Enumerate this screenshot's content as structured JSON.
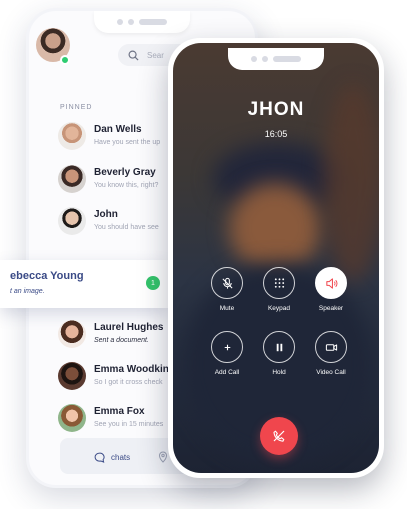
{
  "chat_app": {
    "search": {
      "placeholder": "Sear"
    },
    "pinned_label": "PINNED",
    "chats": [
      {
        "name": "Dan Wells",
        "message": "Have you sent the up"
      },
      {
        "name": "Beverly Gray",
        "message": "You know this, right?"
      },
      {
        "name": "John",
        "message": "You should have see"
      }
    ],
    "highlighted_chat": {
      "name": "ebecca Young",
      "message": "t an image.",
      "unread_count": "1"
    },
    "recent_chats": [
      {
        "name": "Laurel Hughes",
        "message": "Sent a document."
      },
      {
        "name": "Emma Woodkin",
        "message": "So I got it cross check"
      },
      {
        "name": "Emma Fox",
        "message": "See you in 15 minutes"
      }
    ],
    "tabbar": {
      "chats_label": "chats"
    },
    "colors": {
      "accent": "#3a4a86",
      "online": "#2ecc71",
      "badge": "#34c46b"
    }
  },
  "call_screen": {
    "caller_name": "JHON",
    "duration": "16:05",
    "controls": [
      {
        "label": "Mute",
        "icon": "mic-off-icon"
      },
      {
        "label": "Keypad",
        "icon": "keypad-icon"
      },
      {
        "label": "Speaker",
        "icon": "speaker-icon",
        "active": true
      },
      {
        "label": "Add Call",
        "icon": "plus-icon"
      },
      {
        "label": "Hold",
        "icon": "pause-icon"
      },
      {
        "label": "Video Call",
        "icon": "video-icon"
      }
    ],
    "end_call_icon": "phone-hangup-icon",
    "colors": {
      "end_call": "#f0464d",
      "speaker_icon": "#f0464d"
    }
  }
}
